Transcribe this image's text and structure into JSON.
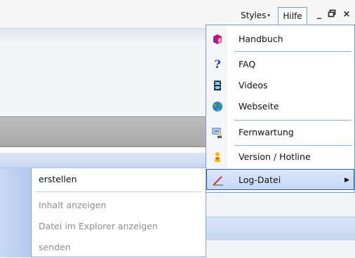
{
  "titlebar": {
    "styles_label": "Styles",
    "styles_arrow": "▾",
    "hilfe_label": "Hilfe",
    "minimize_glyph": "_",
    "restore_glyph": "🗗",
    "close_glyph": "×"
  },
  "help_menu": {
    "items": [
      {
        "label": "Handbuch",
        "icon": "book-icon"
      },
      {
        "label": "FAQ",
        "icon": "question-icon"
      },
      {
        "label": "Videos",
        "icon": "film-icon"
      },
      {
        "label": "Webseite",
        "icon": "globe-icon"
      },
      {
        "label": "Fernwartung",
        "icon": "remote-support-icon"
      },
      {
        "label": "Version / Hotline",
        "icon": "info-person-icon"
      },
      {
        "label": "Log-Datei",
        "icon": "pencil-line-icon",
        "submenu_arrow": "▶"
      }
    ]
  },
  "log_submenu": {
    "items": [
      {
        "label": "erstellen",
        "enabled": true
      },
      {
        "label": "Inhalt anzeigen",
        "enabled": false
      },
      {
        "label": "Datei im Explorer anzeigen",
        "enabled": false
      },
      {
        "label": "senden",
        "enabled": false
      }
    ]
  },
  "colors": {
    "menu_border": "#7a9ccf",
    "highlight_border": "#2f5fb0",
    "separator": "#8eb0e0",
    "disabled_text": "#8f8f8f"
  }
}
